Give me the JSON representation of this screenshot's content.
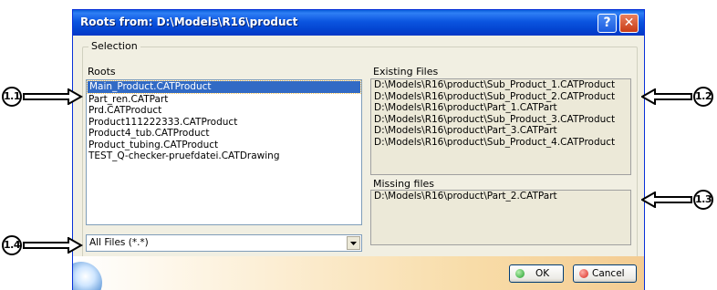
{
  "dialog": {
    "title": "Roots from: D:\\Models\\R16\\product",
    "help_glyph": "?",
    "close_glyph": "✕"
  },
  "selection": {
    "legend": "Selection",
    "roots_label": "Roots",
    "roots": [
      "Main_Product.CATProduct",
      "Part_ren.CATPart",
      "Prd.CATProduct",
      "Product111222333.CATProduct",
      "Product4_tub.CATProduct",
      "Product_tubing.CATProduct",
      "TEST_Q-checker-pruefdatei.CATDrawing"
    ],
    "selected_index": 0,
    "filter_value": "All Files (*.*)"
  },
  "existing": {
    "label": "Existing Files",
    "files": [
      "D:\\Models\\R16\\product\\Sub_Product_1.CATProduct",
      "D:\\Models\\R16\\product\\Sub_Product_2.CATProduct",
      "D:\\Models\\R16\\product\\Part_1.CATPart",
      "D:\\Models\\R16\\product\\Sub_Product_3.CATProduct",
      "D:\\Models\\R16\\product\\Part_3.CATPart",
      "D:\\Models\\R16\\product\\Sub_Product_4.CATProduct"
    ]
  },
  "missing": {
    "label": "Missing files",
    "files": [
      "D:\\Models\\R16\\product\\Part_2.CATPart"
    ]
  },
  "buttons": {
    "ok": "OK",
    "cancel": "Cancel"
  },
  "callouts": {
    "c1": "1.1",
    "c2": "1.2",
    "c3": "1.3",
    "c4": "1.4"
  },
  "colors": {
    "ok_dot": "#1e9e2a",
    "cancel_dot": "#d8281e"
  }
}
